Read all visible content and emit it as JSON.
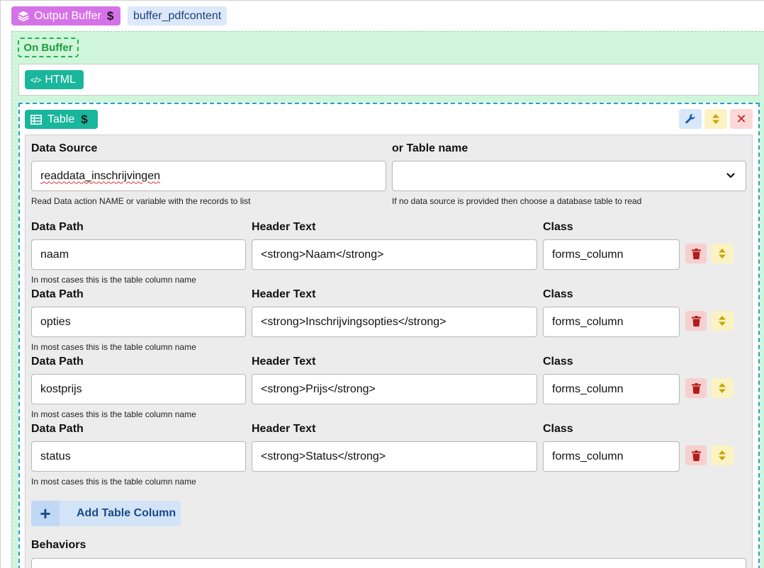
{
  "header": {
    "badge_label": "Output Buffer",
    "badge_dollar": "$",
    "variable_chip": "buffer_pdfcontent"
  },
  "on_buffer": {
    "label": "On Buffer"
  },
  "html_block": {
    "label": "HTML",
    "icon": "code-icon"
  },
  "table_block": {
    "label": "Table",
    "dollar": "$",
    "tools": {
      "wrench": "wrench-icon",
      "move": "move-icon",
      "close": "✕"
    }
  },
  "data_source": {
    "label": "Data Source",
    "value": "readdata_inschrijvingen",
    "help": "Read Data action NAME or variable with the records to list"
  },
  "table_name": {
    "label": "or Table name",
    "value": "",
    "help": "If no data source is provided then choose a database table to read"
  },
  "columns": [
    {
      "path_label": "Data Path",
      "path": "naam",
      "header_label": "Header Text",
      "header": "<strong>Naam</strong>",
      "class_label": "Class",
      "class": "forms_column",
      "help": "In most cases this is the table column name"
    },
    {
      "path_label": "Data Path",
      "path": "opties",
      "header_label": "Header Text",
      "header": "<strong>Inschrijvingsopties</strong>",
      "class_label": "Class",
      "class": "forms_column",
      "help": "In most cases this is the table column name"
    },
    {
      "path_label": "Data Path",
      "path": "kostprijs",
      "header_label": "Header Text",
      "header": "<strong>Prijs</strong>",
      "class_label": "Class",
      "class": "forms_column",
      "help": "In most cases this is the table column name"
    },
    {
      "path_label": "Data Path",
      "path": "status",
      "header_label": "Header Text",
      "header": "<strong>Status</strong>",
      "class_label": "Class",
      "class": "forms_column",
      "help": "In most cases this is the table column name"
    }
  ],
  "add_column": {
    "icon": "+",
    "label": "Add Table Column"
  },
  "behaviors": {
    "label": "Behaviors"
  },
  "colors": {
    "output_buffer": "#d672e8",
    "badge_teal": "#19b69c",
    "green_bg": "#cff6da",
    "table_border": "#2c9bd3",
    "delete_red": "#b01c1c",
    "move_yellow": "#c9a400"
  }
}
